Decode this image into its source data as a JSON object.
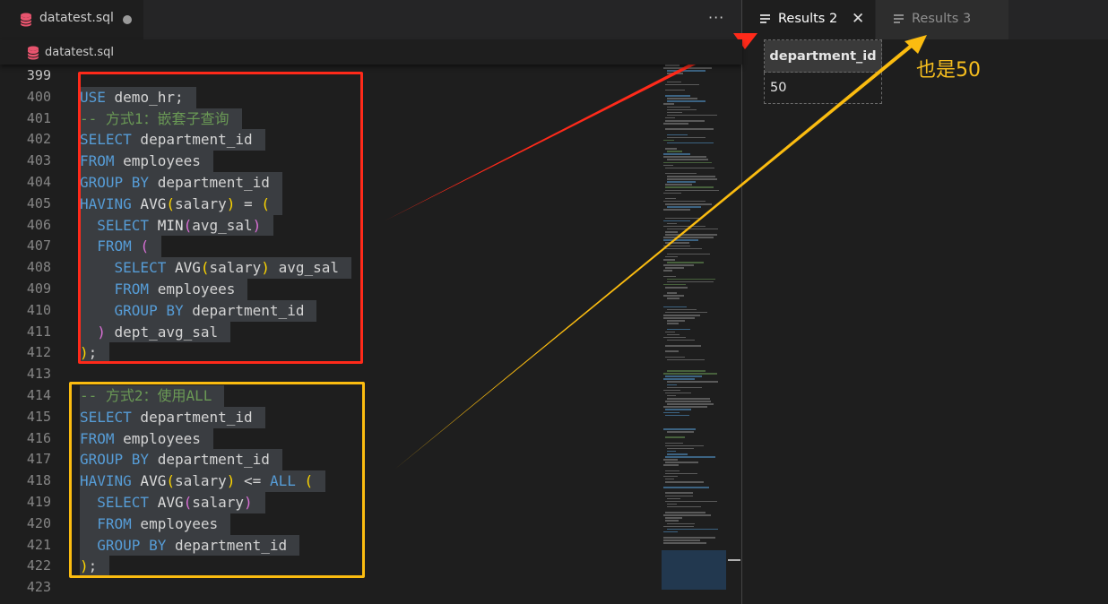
{
  "editor": {
    "tab_title": "datatest.sql",
    "breadcrumb": "datatest.sql",
    "more_actions": "···"
  },
  "code_lines": [
    {
      "num": "399",
      "tokens": []
    },
    {
      "num": "400",
      "sel": true,
      "tokens": [
        {
          "t": "kw",
          "v": "USE"
        },
        {
          "t": "id",
          "v": " demo_hr;"
        }
      ]
    },
    {
      "num": "401",
      "sel": true,
      "tokens": [
        {
          "t": "cm",
          "v": "-- 方式1：嵌套子查询"
        }
      ]
    },
    {
      "num": "402",
      "sel": true,
      "tokens": [
        {
          "t": "kw",
          "v": "SELECT"
        },
        {
          "t": "id",
          "v": " department_id"
        }
      ]
    },
    {
      "num": "403",
      "sel": true,
      "tokens": [
        {
          "t": "kw",
          "v": "FROM"
        },
        {
          "t": "id",
          "v": " employees"
        }
      ]
    },
    {
      "num": "404",
      "sel": true,
      "tokens": [
        {
          "t": "kw",
          "v": "GROUP BY"
        },
        {
          "t": "id",
          "v": " department_id"
        }
      ]
    },
    {
      "num": "405",
      "sel": true,
      "tokens": [
        {
          "t": "kw",
          "v": "HAVING"
        },
        {
          "t": "fn",
          "v": " AVG"
        },
        {
          "t": "p1",
          "v": "("
        },
        {
          "t": "id",
          "v": "salary"
        },
        {
          "t": "p1",
          "v": ")"
        },
        {
          "t": "op",
          "v": " = "
        },
        {
          "t": "p1",
          "v": "("
        }
      ]
    },
    {
      "num": "406",
      "sel": true,
      "tokens": [
        {
          "t": "kw",
          "v": "  SELECT"
        },
        {
          "t": "fn",
          "v": " MIN"
        },
        {
          "t": "p2",
          "v": "("
        },
        {
          "t": "id",
          "v": "avg_sal"
        },
        {
          "t": "p2",
          "v": ")"
        }
      ]
    },
    {
      "num": "407",
      "sel": true,
      "tokens": [
        {
          "t": "kw",
          "v": "  FROM"
        },
        {
          "t": "id",
          "v": " "
        },
        {
          "t": "p2",
          "v": "("
        }
      ]
    },
    {
      "num": "408",
      "sel": true,
      "tokens": [
        {
          "t": "kw",
          "v": "    SELECT"
        },
        {
          "t": "fn",
          "v": " AVG"
        },
        {
          "t": "p1",
          "v": "("
        },
        {
          "t": "id",
          "v": "salary"
        },
        {
          "t": "p1",
          "v": ")"
        },
        {
          "t": "id",
          "v": " avg_sal"
        }
      ]
    },
    {
      "num": "409",
      "sel": true,
      "tokens": [
        {
          "t": "kw",
          "v": "    FROM"
        },
        {
          "t": "id",
          "v": " employees"
        }
      ]
    },
    {
      "num": "410",
      "sel": true,
      "tokens": [
        {
          "t": "kw",
          "v": "    GROUP BY"
        },
        {
          "t": "id",
          "v": " department_id"
        }
      ]
    },
    {
      "num": "411",
      "sel": true,
      "tokens": [
        {
          "t": "p2",
          "v": "  )"
        },
        {
          "t": "id",
          "v": " dept_avg_sal"
        }
      ]
    },
    {
      "num": "412",
      "sel": true,
      "tokens": [
        {
          "t": "p1",
          "v": ")"
        },
        {
          "t": "id",
          "v": ";"
        }
      ]
    },
    {
      "num": "413",
      "sel": true,
      "tokens": []
    },
    {
      "num": "414",
      "sel": true,
      "tokens": [
        {
          "t": "cm",
          "v": "-- 方式2：使用ALL"
        }
      ]
    },
    {
      "num": "415",
      "sel": true,
      "tokens": [
        {
          "t": "kw",
          "v": "SELECT"
        },
        {
          "t": "id",
          "v": " department_id"
        }
      ]
    },
    {
      "num": "416",
      "sel": true,
      "tokens": [
        {
          "t": "kw",
          "v": "FROM"
        },
        {
          "t": "id",
          "v": " employees"
        }
      ]
    },
    {
      "num": "417",
      "sel": true,
      "tokens": [
        {
          "t": "kw",
          "v": "GROUP BY"
        },
        {
          "t": "id",
          "v": " department_id"
        }
      ]
    },
    {
      "num": "418",
      "sel": true,
      "tokens": [
        {
          "t": "kw",
          "v": "HAVING"
        },
        {
          "t": "fn",
          "v": " AVG"
        },
        {
          "t": "p1",
          "v": "("
        },
        {
          "t": "id",
          "v": "salary"
        },
        {
          "t": "p1",
          "v": ")"
        },
        {
          "t": "op",
          "v": " <= "
        },
        {
          "t": "kw",
          "v": "ALL"
        },
        {
          "t": "id",
          "v": " "
        },
        {
          "t": "p1",
          "v": "("
        }
      ]
    },
    {
      "num": "419",
      "sel": true,
      "tokens": [
        {
          "t": "kw",
          "v": "  SELECT"
        },
        {
          "t": "fn",
          "v": " AVG"
        },
        {
          "t": "p2",
          "v": "("
        },
        {
          "t": "id",
          "v": "salary"
        },
        {
          "t": "p2",
          "v": ")"
        }
      ]
    },
    {
      "num": "420",
      "sel": true,
      "tokens": [
        {
          "t": "kw",
          "v": "  FROM"
        },
        {
          "t": "id",
          "v": " employees"
        }
      ]
    },
    {
      "num": "421",
      "sel": true,
      "tokens": [
        {
          "t": "kw",
          "v": "  GROUP BY"
        },
        {
          "t": "id",
          "v": " department_id"
        }
      ]
    },
    {
      "num": "422",
      "sel": true,
      "tokens": [
        {
          "t": "p1",
          "v": ")"
        },
        {
          "t": "id",
          "v": ";"
        }
      ]
    },
    {
      "num": "423",
      "tokens": []
    }
  ],
  "results": {
    "tabs": [
      {
        "label": "Results 2",
        "active": true
      },
      {
        "label": "Results 3",
        "active": false
      }
    ],
    "close_glyph": "✕",
    "columns": [
      "department_id"
    ],
    "rows": [
      [
        "50"
      ]
    ]
  },
  "annotation": "也是50",
  "colors": {
    "keyword": "#569cd6",
    "comment": "#6a9955",
    "red_box": "#ff2a1a",
    "yellow_box": "#fbbc10",
    "annotation": "#f5bd1e"
  }
}
